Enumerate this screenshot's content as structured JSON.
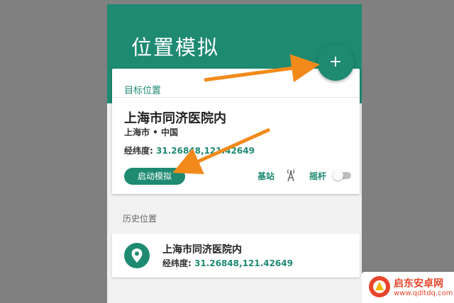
{
  "header": {
    "title": "位置模拟",
    "accent": "#1e8a72"
  },
  "fab": {
    "label": "+"
  },
  "target": {
    "section_label": "目标位置",
    "name": "上海市同济医院内",
    "region": "上海市 • 中国",
    "coord_label": "经纬度:",
    "coord_value": "31.26848,121.42649",
    "start_button": "启动模拟",
    "station_label": "基站",
    "station_icon": "signal-tower-icon",
    "joystick_label": "摇杆",
    "joystick_enabled": false
  },
  "history": {
    "section_label": "历史位置",
    "items": [
      {
        "name": "上海市同济医院内",
        "coord_label": "经纬度:",
        "coord_value": "31.26848,121.42649",
        "icon": "location-pin-icon"
      }
    ]
  },
  "watermark": {
    "title": "启东安卓网",
    "url": "www.qdltdq.com",
    "color": "#e8452b"
  }
}
